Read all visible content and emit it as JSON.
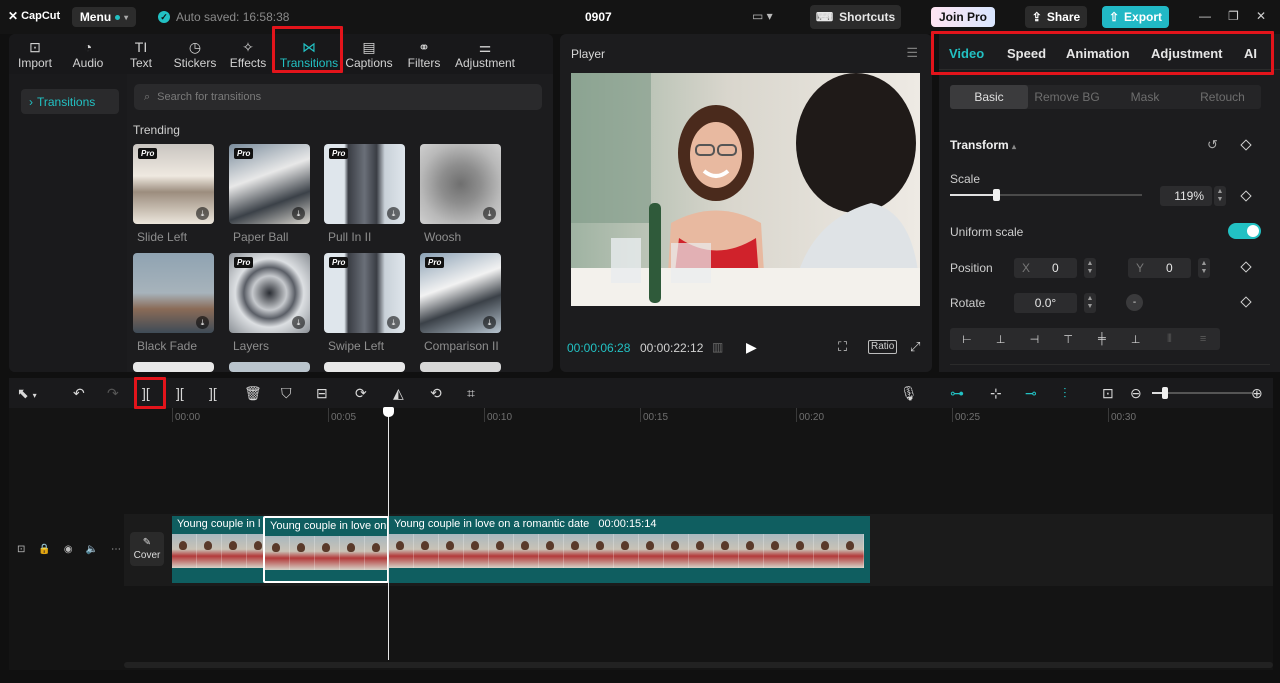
{
  "app": {
    "logo_text": "CapCut",
    "menu_label": "Menu",
    "autosave_text": "Auto saved: 16:58:38",
    "project_title": "0907",
    "shortcuts_label": "Shortcuts",
    "join_pro_label": "Join Pro",
    "share_label": "Share",
    "export_label": "Export",
    "accent_color": "#22c1c3",
    "annotation_color": "#e3141b"
  },
  "media_tabs": [
    {
      "label": "Import",
      "icon": "import-icon"
    },
    {
      "label": "Audio",
      "icon": "audio-icon"
    },
    {
      "label": "Text",
      "icon": "text-icon"
    },
    {
      "label": "Stickers",
      "icon": "stickers-icon"
    },
    {
      "label": "Effects",
      "icon": "effects-icon"
    },
    {
      "label": "Transitions",
      "icon": "transitions-icon",
      "active": true
    },
    {
      "label": "Captions",
      "icon": "captions-icon"
    },
    {
      "label": "Filters",
      "icon": "filters-icon"
    },
    {
      "label": "Adjustment",
      "icon": "adjustment-icon"
    }
  ],
  "left_nav": {
    "item": "Transitions"
  },
  "search": {
    "placeholder": "Search for transitions"
  },
  "trending": {
    "title": "Trending",
    "items": [
      {
        "label": "Slide Left",
        "pro": true
      },
      {
        "label": "Paper Ball",
        "pro": true
      },
      {
        "label": "Pull In II",
        "pro": true
      },
      {
        "label": "Woosh",
        "pro": false
      },
      {
        "label": "Black Fade",
        "pro": false
      },
      {
        "label": "Layers",
        "pro": true
      },
      {
        "label": "Swipe Left",
        "pro": true
      },
      {
        "label": "Comparison II",
        "pro": true
      }
    ],
    "pro_badge": "Pro"
  },
  "player": {
    "title": "Player",
    "current_time": "00:00:06:28",
    "total_time": "00:00:22:12",
    "ratio_label": "Ratio"
  },
  "properties": {
    "tabs": [
      "Video",
      "Speed",
      "Animation",
      "Adjustment",
      "AI"
    ],
    "active_tab": "Video",
    "sub_tabs": [
      "Basic",
      "Remove BG",
      "Mask",
      "Retouch"
    ],
    "active_sub_tab": "Basic",
    "section_title": "Transform",
    "scale_label": "Scale",
    "scale_value": "119%",
    "scale_fraction": 0.24,
    "uniform_scale_label": "Uniform scale",
    "uniform_scale_on": true,
    "position_label": "Position",
    "pos_x_label": "X",
    "pos_x_value": "0",
    "pos_y_label": "Y",
    "pos_y_value": "0",
    "rotate_label": "Rotate",
    "rotate_value": "0.0°"
  },
  "timeline": {
    "ruler": [
      "00:00",
      "00:05",
      "00:10",
      "00:15",
      "00:20",
      "00:25",
      "00:30"
    ],
    "clips": [
      {
        "label": "Young couple in l"
      },
      {
        "label": "Young couple in love on",
        "selected": true
      },
      {
        "label": "Young couple in love on a romantic date",
        "duration": "00:00:15:14"
      }
    ],
    "cover_label": "Cover"
  }
}
